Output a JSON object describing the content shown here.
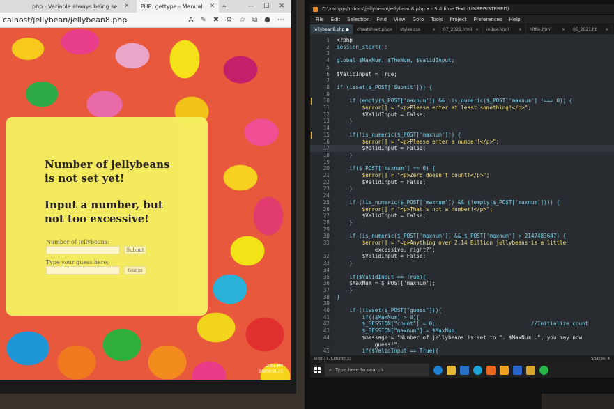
{
  "browser": {
    "tabs": [
      {
        "label": "php - Variable always being se"
      },
      {
        "label": "PHP: gettype - Manual"
      }
    ],
    "url": "calhost/jellybean/jellybean8.php",
    "new_tab": "+",
    "page": {
      "status_heading": "Number of jellybeans is not set yet!",
      "prompt_heading": "Input a number, but not too excessive!",
      "max_label": "Number of Jellybeans:",
      "max_button": "Submit",
      "guess_label": "Type your guess here:",
      "guess_button": "Guess"
    },
    "clock": {
      "time": "2:51 PM",
      "date": "20/08/2021"
    }
  },
  "editor": {
    "title": "C:\\xampp\\htdocs\\jellybean\\jellybean8.php • - Sublime Text (UNREGISTERED)",
    "menu": [
      "File",
      "Edit",
      "Selection",
      "Find",
      "View",
      "Goto",
      "Tools",
      "Project",
      "Preferences",
      "Help"
    ],
    "tabs": [
      {
        "label": "jellybean8.php",
        "active": true
      },
      {
        "label": "cheatsheet.php",
        "active": false
      },
      {
        "label": "styles.css",
        "active": false
      },
      {
        "label": "07_2021.html",
        "active": false
      },
      {
        "label": "index.html",
        "active": false
      },
      {
        "label": "hlttle.html",
        "active": false
      },
      {
        "label": "06_2021.ht",
        "active": false
      }
    ],
    "current_line": 17,
    "modified_lines": [
      10,
      15
    ],
    "lines": [
      "<?php",
      "session_start();",
      "",
      "global $MaxNum, $TheNum, $ValidInput;",
      "",
      "$ValidInput = True;",
      "",
      "if (isset($_POST['Submit'])) {",
      "",
      "    if (empty($_POST['maxnum']) && !is_numeric($_POST['maxnum'] !=== 0)) {",
      "        $error[] = \"<p>Please enter at least something!</p>\";",
      "        $ValidInput = False;",
      "    }",
      "",
      "    if(!is_numeric($_POST['maxnum'])) {",
      "        $error[] = \"<p>Please enter a number!</p>\";",
      "        $ValidInput = False;",
      "    }",
      "",
      "    if($_POST['maxnum'] == 0) {",
      "        $error[] = \"<p>Zero doesn't count!</p>\";",
      "        $ValidInput = False;",
      "    }",
      "",
      "    if (!is_numeric($_POST['maxnum']) && (!empty($_POST['maxnum']))) {",
      "        $error[] = \"<p>That's not a number!</p>\";",
      "        $ValidInput = False;",
      "    }",
      "",
      "    if (is_numeric($_POST['maxnum']) && $_POST['maxnum'] > 2147483647) {",
      "        $error[] = \"<p>Anything over 2.14 Billion jellybeans is a little",
      "            excessive, right?\";",
      "        $ValidInput = False;",
      "    }",
      "",
      "    if($ValidInput == True){",
      "    $MaxNum = $_POST['maxnum'];",
      "    }",
      "}",
      "",
      "    if (!isset($_POST[\"guess\"])){",
      "        if(($MaxNum) > 0){",
      "        $_SESSION[\"count\"] = 0;                              //Initialize count",
      "        $_SESSION[\"maxnum\"] = $MaxNum;",
      "        $message = \"Number of jellybeans is set to \". $MaxNum .\", you may now",
      "            guess!\";",
      "        if($ValidInput == True){"
    ],
    "line_numbers": [
      "1",
      "2",
      "3",
      "4",
      "5",
      "6",
      "7",
      "8",
      "9",
      "10",
      "11",
      "12",
      "13",
      "14",
      "15",
      "16",
      "17",
      "18",
      "19",
      "20",
      "21",
      "22",
      "23",
      "24",
      "25",
      "26",
      "27",
      "28",
      "29",
      "30",
      "31",
      "",
      "32",
      "33",
      "34",
      "35",
      "36",
      "37",
      "38",
      "39",
      "40",
      "41",
      "42",
      "43",
      "44",
      "",
      "45"
    ],
    "status_left": "Line 17, Column 33",
    "status_right": "Spaces: 4"
  },
  "taskbar": {
    "search_placeholder": "Type here to search"
  }
}
